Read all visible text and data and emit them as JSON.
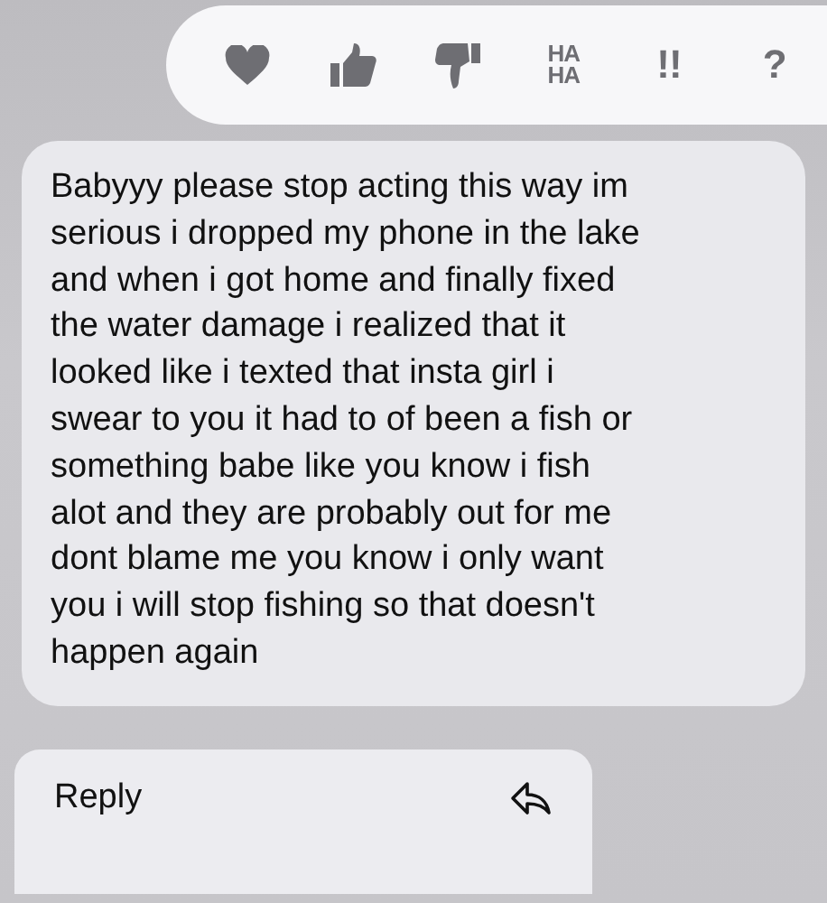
{
  "reactions": [
    {
      "kind": "heart"
    },
    {
      "kind": "thumbs-up"
    },
    {
      "kind": "thumbs-down"
    },
    {
      "kind": "text",
      "label": "HA\nHA"
    },
    {
      "kind": "text",
      "label": "!!"
    },
    {
      "kind": "text",
      "label": "?"
    }
  ],
  "message": "Babyyy please stop acting this way im\nserious i dropped my phone in the lake\nand when i got home and finally fixed\nthe water damage i realized that it\nlooked like i texted that insta girl i\nswear to you it had to of been a fish or\nsomething babe like you know i fish\nalot and they are probably out for me\ndont blame me you know i only want\nyou i will stop fishing so that doesn't\nhappen again",
  "menu": [
    {
      "label": "Reply"
    }
  ]
}
